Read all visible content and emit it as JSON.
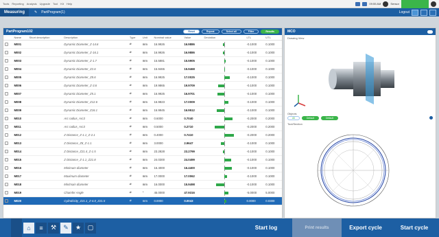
{
  "app": {
    "menu": [
      "Tools",
      "Reporting",
      "Analysis",
      "Upgrade",
      "Tool",
      "Kit",
      "Help"
    ]
  },
  "titlebar": {
    "clock1": "09:55 AM",
    "user": "Sensor"
  },
  "subbar": {
    "tab": "Measuring",
    "crumb": "PartProgram(1)",
    "logout": "Logout"
  },
  "panel": {
    "title": "PartProgram102",
    "chips": [
      "Reset",
      "Repeat",
      "Select all",
      "Filter",
      "Results"
    ]
  },
  "table": {
    "headers": [
      "Name",
      "Short description",
      "Description",
      "Type",
      "Unit",
      "Nominal value",
      "Value",
      "Deviation",
      "LTL",
      "UTL"
    ],
    "rows": [
      {
        "name": "M001",
        "desc": "Dynamic Diameter_Z-14.6",
        "unit": "mm",
        "nom": "16.9926",
        "val": "16.9886",
        "ltl": "-0.1000",
        "utl": "0.1000",
        "bar": -2
      },
      {
        "name": "M002",
        "desc": "Dynamic Diameter_Z-16.1",
        "unit": "mm",
        "nom": "16.9926",
        "val": "16.9886",
        "ltl": "-0.1000",
        "utl": "0.1000",
        "bar": -2
      },
      {
        "name": "M003",
        "desc": "Dynamic Diameter_Z-1.7",
        "unit": "mm",
        "nom": "15.5881",
        "val": "15.5905",
        "ltl": "-0.1000",
        "utl": "0.1000",
        "bar": 2
      },
      {
        "name": "M004",
        "desc": "Dynamic Diameter_Z2.6",
        "unit": "mm",
        "nom": "15.9465",
        "val": "15.9468",
        "ltl": "-0.1000",
        "utl": "0.1000",
        "bar": 1
      },
      {
        "name": "M005",
        "desc": "Dynamic Diameter_Z8.6",
        "unit": "mm",
        "nom": "16.9925",
        "val": "17.0025",
        "ltl": "-0.1000",
        "utl": "0.1000",
        "bar": 8
      },
      {
        "name": "M006",
        "desc": "Dynamic Diameter_Z-3.6",
        "unit": "mm",
        "nom": "19.9865",
        "val": "19.9709",
        "ltl": "-0.1000",
        "utl": "0.1000",
        "bar": -9
      },
      {
        "name": "M007",
        "desc": "Dynamic Diameter_Z5.1",
        "unit": "mm",
        "nom": "16.9925",
        "val": "16.9701",
        "ltl": "-0.1000",
        "utl": "0.1000",
        "bar": -10
      },
      {
        "name": "M008",
        "desc": "Dynamic Diameter_Z12.6",
        "unit": "mm",
        "nom": "16.9823",
        "val": "17.0009",
        "ltl": "-0.1000",
        "utl": "0.1000",
        "bar": 6
      },
      {
        "name": "M009",
        "desc": "Dynamic Diameter_Z16.1",
        "unit": "mm",
        "nom": "16.9945",
        "val": "16.9512",
        "ltl": "-0.1000",
        "utl": "0.1000",
        "bar": -11
      },
      {
        "name": "M010",
        "desc": "Arc radius_Arc3",
        "unit": "mm",
        "nom": "0.6000",
        "val": "0.7040",
        "ltl": "-0.2000",
        "utl": "0.2000",
        "bar": 12
      },
      {
        "name": "M011",
        "desc": "Arc radius_Arc3",
        "unit": "mm",
        "nom": "0.5000",
        "val": "0.2710",
        "ltl": "-0.2000",
        "utl": "0.2000",
        "bar": -14
      },
      {
        "name": "M012",
        "desc": "Z Distance_Z-1.1_Z-2.1",
        "unit": "mm",
        "nom": "0.4000",
        "val": "0.7410",
        "ltl": "-0.2000",
        "utl": "0.2000",
        "bar": 14
      },
      {
        "name": "M013",
        "desc": "Z Distance_Z8_Z-1.1",
        "unit": "mm",
        "nom": "3.0000",
        "val": "2.9647",
        "ltl": "-0.1000",
        "utl": "0.1000",
        "bar": -5
      },
      {
        "name": "M014",
        "desc": "Z Distance_Z21.4_Z-1.5",
        "unit": "mm",
        "nom": "23.2828",
        "val": "23.2799",
        "ltl": "-0.1000",
        "utl": "0.1000",
        "bar": -2
      },
      {
        "name": "M015",
        "desc": "Z Distance_Z-1.1_Z21.8",
        "unit": "mm",
        "nom": "24.0300",
        "val": "24.0499",
        "ltl": "-0.1000",
        "utl": "0.1000",
        "bar": 10
      },
      {
        "name": "M016",
        "desc": "Minimum diameter",
        "unit": "mm",
        "nom": "16.4000",
        "val": "16.4400",
        "ltl": "-0.1000",
        "utl": "0.1000",
        "bar": 11
      },
      {
        "name": "M017",
        "desc": "Maximum diameter",
        "unit": "mm",
        "nom": "17.0000",
        "val": "17.0062",
        "ltl": "-0.1000",
        "utl": "0.1000",
        "bar": 4
      },
      {
        "name": "M018",
        "desc": "Min/main diameter",
        "unit": "mm",
        "nom": "16.0000",
        "val": "15.9498",
        "ltl": "-0.1000",
        "utl": "0.1000",
        "bar": -12
      },
      {
        "name": "M019",
        "desc": "Chamfer Angle",
        "unit": "°",
        "nom": "45.0000",
        "val": "47.9316",
        "ltl": "-5.0000",
        "utl": "5.0000",
        "bar": 6
      },
      {
        "name": "M020",
        "desc": "Cylindricity_Z21.1_Z-4.0_Z21.5",
        "unit": "mm",
        "nom": "0.0000",
        "val": "0.0043",
        "ltl": "0.0000",
        "utl": "0.0300",
        "bar": 3,
        "selected": true
      }
    ]
  },
  "right": {
    "header": "MCO",
    "drawing_view": "Drawing View",
    "objects_label": "Objects",
    "objects_chips": [
      "All",
      "Default",
      "Default"
    ],
    "tool_section": "Tool/Section"
  },
  "bottom": {
    "start_log": "Start log",
    "print": "Print results",
    "export": "Export cycle",
    "start": "Start cycle"
  },
  "colors": {
    "accent": "#1d5fa3",
    "good": "#2fa84a"
  }
}
